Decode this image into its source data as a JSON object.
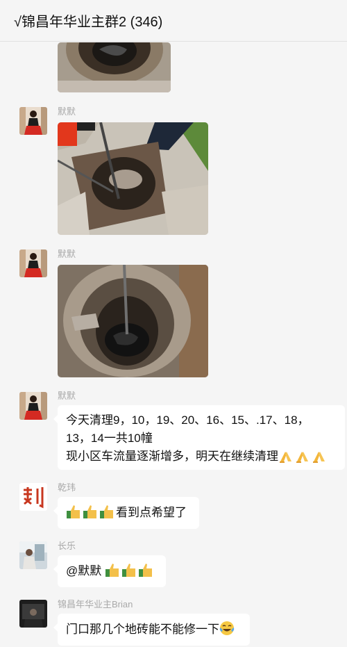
{
  "header": {
    "title": "√锦昌年华业主群2 (346)"
  },
  "messages": [
    {
      "sender": "默默"
    },
    {
      "sender": "默默"
    },
    {
      "sender": "默默",
      "line1": "今天清理9，10，19、20、16、15、.17、18，",
      "line2": "13，14一共10幢",
      "line3": "现小区车流量逐渐增多，明天在继续清理"
    },
    {
      "sender": "乾玮",
      "text": "看到点希望了"
    },
    {
      "sender": "长乐",
      "text": "@默默 "
    },
    {
      "sender": "锦昌年华业主Brian",
      "text": "门口那几个地砖能不能修一下"
    }
  ],
  "icons": {
    "pray": "praying-hands-emoji",
    "thumb": "thumbs-up-emoji",
    "laugh": "tears-of-joy-emoji"
  },
  "colors": {
    "background": "#f5f5f5",
    "bubble": "#ffffff",
    "sender": "#a9a9a9"
  }
}
